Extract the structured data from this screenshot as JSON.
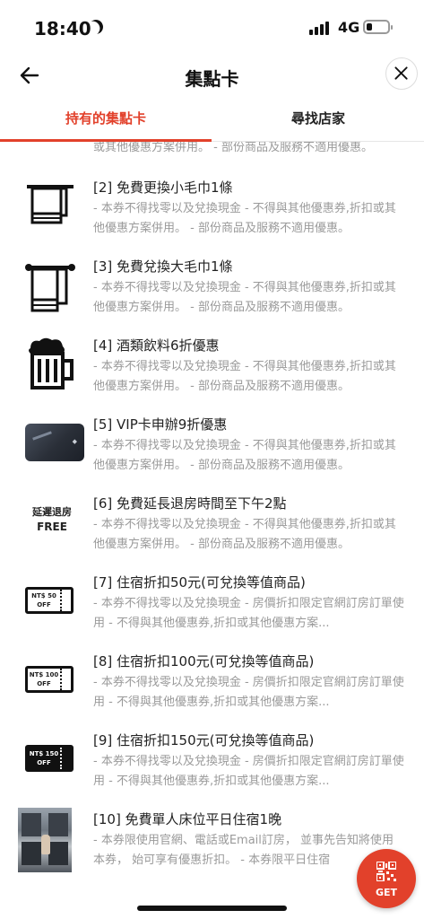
{
  "status_bar": {
    "time": "18:40",
    "network": "4G"
  },
  "header": {
    "title": "集點卡"
  },
  "tabs": [
    {
      "label": "持有的集點卡"
    },
    {
      "label": "尋找店家"
    }
  ],
  "partial_item": {
    "desc": "或其他優惠方案併用。 - 部份商品及服務不適用優惠。"
  },
  "items": [
    {
      "name": "[2] 免費更換小毛巾1條",
      "desc": "- 本券不得找零以及兌換現金 - 不得與其他優惠券,折扣或其他優惠方案併用。 - 部份商品及服務不適用優惠。",
      "icon": "small-towel-icon"
    },
    {
      "name": "[3] 免費兌換大毛巾1條",
      "desc": "- 本券不得找零以及兌換現金 - 不得與其他優惠券,折扣或其他優惠方案併用。 - 部份商品及服務不適用優惠。",
      "icon": "large-towel-icon"
    },
    {
      "name": "[4] 酒類飲料6折優惠",
      "desc": "- 本券不得找零以及兌換現金 - 不得與其他優惠券,折扣或其他優惠方案併用。 - 部份商品及服務不適用優惠。",
      "icon": "beer-mug-icon"
    },
    {
      "name": "[5] VIP卡申辦9折優惠",
      "desc": "- 本券不得找零以及兌換現金 - 不得與其他優惠券,折扣或其他優惠方案併用。 - 部份商品及服務不適用優惠。",
      "icon": "vip-card-image"
    },
    {
      "name": "[6] 免費延長退房時間至下午2點",
      "desc": "- 本券不得找零以及兌換現金 - 不得與其他優惠券,折扣或其他優惠方案併用。 - 部份商品及服務不適用優惠。",
      "icon": "late-checkout-icon",
      "icon_text": [
        "延遲退房",
        "FREE"
      ]
    },
    {
      "name": "[7] 住宿折扣50元(可兌換等值商品)",
      "desc": "- 本券不得找零以及兌換現金 - 房價折扣限定官網訂房訂單使用 - 不得與其他優惠券,折扣或其他優惠方案...",
      "icon": "ticket-icon",
      "icon_text": [
        "NT$ 50",
        "OFF"
      ]
    },
    {
      "name": "[8] 住宿折扣100元(可兌換等值商品)",
      "desc": "- 本券不得找零以及兌換現金 - 房價折扣限定官網訂房訂單使用 - 不得與其他優惠券,折扣或其他優惠方案...",
      "icon": "ticket-icon",
      "icon_text": [
        "NT$ 100",
        "OFF"
      ]
    },
    {
      "name": "[9] 住宿折扣150元(可兌換等值商品)",
      "desc": "- 本券不得找零以及兌換現金 - 房價折扣限定官網訂房訂單使用 - 不得與其他優惠券,折扣或其他優惠方案...",
      "icon": "ticket-dark-icon",
      "icon_text": [
        "NT$ 150",
        "OFF"
      ]
    },
    {
      "name": "[10] 免費單人床位平日住宿1晚",
      "desc": "- 本券限使用官網、電話或Email訂房， 並事先告知將使用本券， 始可享有優惠折扣。 - 本券限平日住宿",
      "icon": "capsule-room-photo"
    }
  ],
  "get_button": {
    "label": "GET"
  },
  "colors": {
    "accent": "#e2412b",
    "muted_text": "#9a9a9a"
  }
}
